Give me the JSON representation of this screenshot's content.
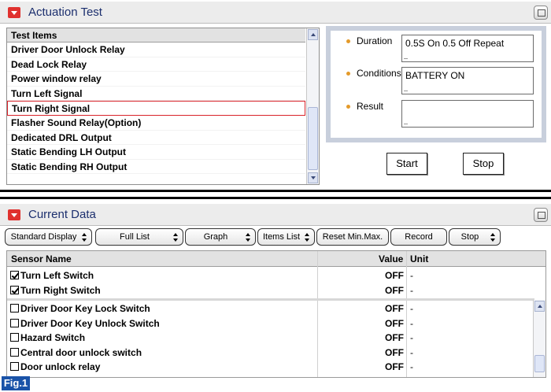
{
  "actuation": {
    "title": "Actuation Test",
    "list_header": "Test Items",
    "items": [
      "Driver Door Unlock Relay",
      "Dead Lock Relay",
      "Power window relay",
      "Turn Left Signal",
      "Turn Right Signal",
      "Flasher Sound Relay(Option)",
      "Dedicated DRL Output",
      "Static Bending LH Output",
      "Static Bending RH Output"
    ],
    "selected_index": 4,
    "duration_label": "Duration",
    "duration_value": "0.5S On 0.5 Off Repeat",
    "conditions_label": "Conditions",
    "conditions_value": "BATTERY ON",
    "result_label": "Result",
    "result_value": "",
    "start_label": "Start",
    "stop_label": "Stop"
  },
  "current_data": {
    "title": "Current Data",
    "toolbar": {
      "standard_display": "Standard Display",
      "full_list": "Full List",
      "graph": "Graph",
      "items_list": "Items List",
      "reset": "Reset Min.Max.",
      "record": "Record",
      "stop": "Stop"
    },
    "columns": {
      "name": "Sensor Name",
      "value": "Value",
      "unit": "Unit"
    },
    "pinned_rows": [
      {
        "name": "Turn Left Switch",
        "checked": true,
        "value": "OFF",
        "unit": "-"
      },
      {
        "name": "Turn Right Switch",
        "checked": true,
        "value": "OFF",
        "unit": "-"
      }
    ],
    "rows": [
      {
        "name": "Driver Door Key Lock Switch",
        "checked": false,
        "value": "OFF",
        "unit": "-"
      },
      {
        "name": "Driver Door Key Unlock Switch",
        "checked": false,
        "value": "OFF",
        "unit": "-"
      },
      {
        "name": "Hazard Switch",
        "checked": false,
        "value": "OFF",
        "unit": "-"
      },
      {
        "name": "Central door unlock switch",
        "checked": false,
        "value": "OFF",
        "unit": "-"
      },
      {
        "name": "Door unlock relay",
        "checked": false,
        "value": "OFF",
        "unit": "-"
      }
    ]
  },
  "figure_label": "Fig.1"
}
